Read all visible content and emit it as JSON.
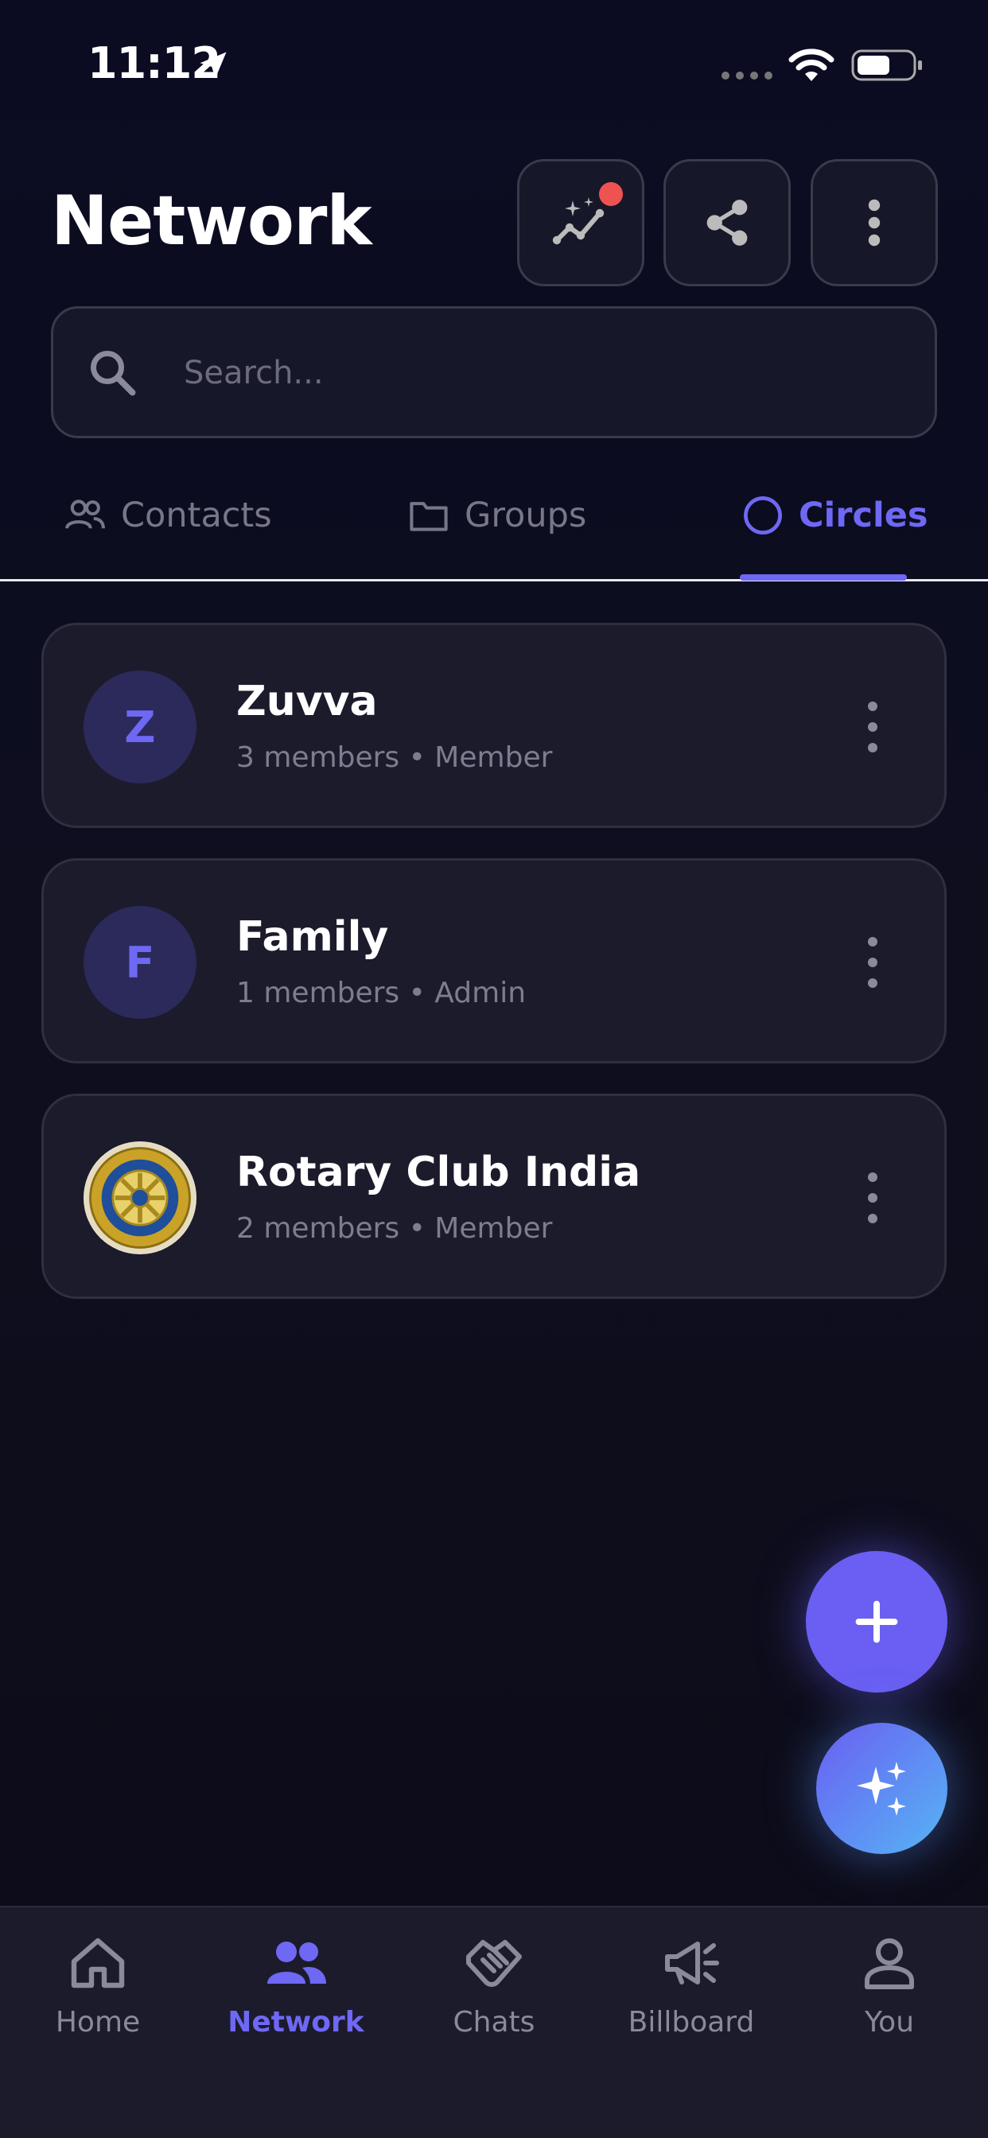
{
  "status_bar": {
    "time": "11:12"
  },
  "header": {
    "title": "Network",
    "actions": [
      {
        "icon": "sparkle-chart-icon",
        "has_notification": true
      },
      {
        "icon": "share-icon"
      },
      {
        "icon": "more-vertical-icon"
      }
    ]
  },
  "search": {
    "placeholder": "Search...",
    "value": ""
  },
  "tabs": [
    {
      "label": "Contacts",
      "icon": "people-icon",
      "active": false
    },
    {
      "label": "Groups",
      "icon": "folder-icon",
      "active": false
    },
    {
      "label": "Circles",
      "icon": "circle-icon",
      "active": true
    }
  ],
  "circles": [
    {
      "initial": "Z",
      "name": "Zuvva",
      "subtitle": "3 members • Member"
    },
    {
      "initial": "F",
      "name": "Family",
      "subtitle": "1 members • Admin"
    },
    {
      "initial": "",
      "logo": "rotary-logo",
      "name": "Rotary Club India",
      "subtitle": "2 members • Member"
    }
  ],
  "fabs": [
    {
      "icon": "plus-icon"
    },
    {
      "icon": "sparkles-icon"
    }
  ],
  "bottom_nav": [
    {
      "label": "Home",
      "icon": "home-icon",
      "active": false
    },
    {
      "label": "Network",
      "icon": "people-icon",
      "active": true
    },
    {
      "label": "Chats",
      "icon": "handshake-icon",
      "active": false
    },
    {
      "label": "Billboard",
      "icon": "megaphone-icon",
      "active": false
    },
    {
      "label": "You",
      "icon": "person-icon",
      "active": false
    }
  ],
  "colors": {
    "accent": "#6e68f5",
    "background": "#0d0d1e",
    "card": "#1c1b2c",
    "notification": "#ef5350"
  }
}
